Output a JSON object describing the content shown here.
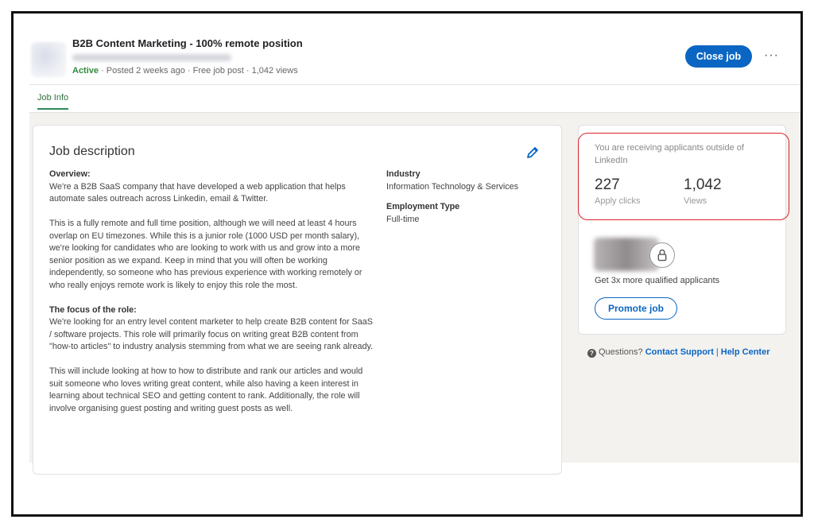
{
  "header": {
    "job_title": "B2B Content Marketing - 100% remote position",
    "status": "Active",
    "meta": " · Posted 2 weeks ago · Free job post · 1,042 views",
    "close_label": "Close job",
    "more_label": "···"
  },
  "tabs": [
    {
      "label": "Job Info"
    }
  ],
  "job_description": {
    "heading": "Job description",
    "overview_title": "Overview:",
    "overview_p1": "We're a B2B SaaS company that have developed a web application that helps automate sales outreach across Linkedin, email & Twitter.",
    "overview_p2": "This is a fully remote and full time position, although we will need at least 4 hours overlap on EU timezones. While this is a junior role (1000 USD per month salary), we're looking for candidates who are looking to work with us and grow into a more senior position as we expand. Keep in mind that you will often be working independently, so someone who has previous experience with working remotely or who really enjoys remote work is likely to enjoy this role the most.",
    "focus_title": "The focus of the role:",
    "focus_p1": "We're looking for an entry level content marketer to help create B2B content for SaaS / software projects. This role will primarily focus on writing great B2B content from \"how-to articles\" to industry analysis stemming from what we are seeing rank already.",
    "focus_p2": "This will include looking at how to how to distribute and rank our articles and would suit someone who loves writing great content, while also having a keen interest in learning about technical SEO and getting content to rank. Additionally, the role will involve organising guest posting and writing guest posts as well."
  },
  "details": {
    "industry_label": "Industry",
    "industry_value": "Information Technology & Services",
    "employment_label": "Employment Type",
    "employment_value": "Full-time"
  },
  "stats": {
    "notice": "You are receiving applicants outside of LinkedIn",
    "apply_clicks_value": "227",
    "apply_clicks_label": "Apply clicks",
    "views_value": "1,042",
    "views_label": "Views"
  },
  "promo": {
    "text": "Get 3x more qualified applicants",
    "button_label": "Promote job"
  },
  "help": {
    "question": "Questions?",
    "contact_link": "Contact Support",
    "separator": "|",
    "help_link": "Help Center"
  },
  "colors": {
    "accent": "#0a66c2",
    "active": "#2f8a3e",
    "highlight_border": "#d9232a"
  }
}
